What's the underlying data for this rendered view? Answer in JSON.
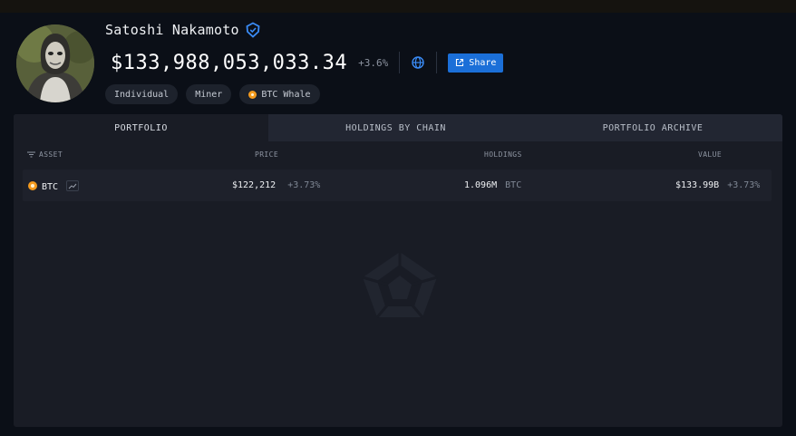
{
  "profile": {
    "name": "Satoshi Nakamoto",
    "total_value": "$133,988,053,033.34",
    "change": "+3.6%",
    "share_label": "Share",
    "tags": [
      {
        "label": "Individual",
        "icon": ""
      },
      {
        "label": "Miner",
        "icon": ""
      },
      {
        "label": "BTC Whale",
        "icon": "btc-coin-icon"
      }
    ]
  },
  "tabs": [
    {
      "label": "PORTFOLIO",
      "active": true
    },
    {
      "label": "HOLDINGS BY CHAIN",
      "active": false
    },
    {
      "label": "PORTFOLIO ARCHIVE",
      "active": false
    }
  ],
  "table": {
    "columns": {
      "asset": "ASSET",
      "price": "PRICE",
      "holdings": "HOLDINGS",
      "value": "VALUE"
    },
    "rows": [
      {
        "asset": "BTC",
        "price": "$122,212",
        "price_change": "+3.73%",
        "holdings": "1.096M",
        "holdings_unit": "BTC",
        "value": "$133.99B",
        "value_change": "+3.73%"
      }
    ]
  },
  "colors": {
    "accent": "#1b6fd8",
    "btc": "#f39a1e",
    "panel": "#191c25",
    "background": "#0b0f17"
  }
}
